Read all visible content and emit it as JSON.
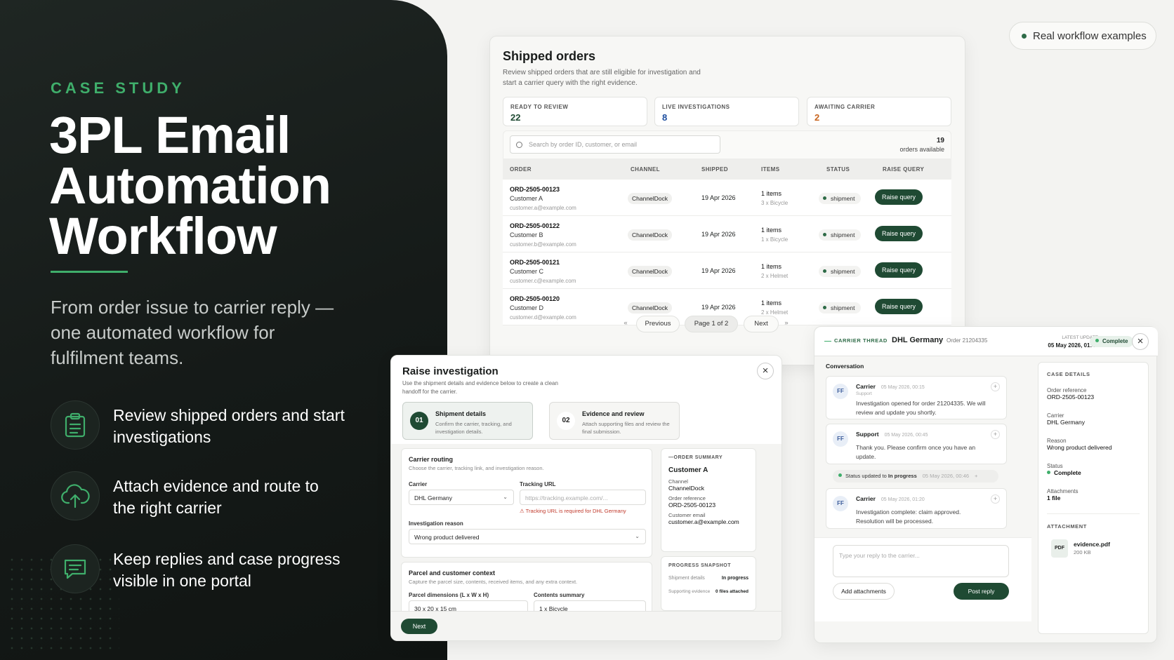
{
  "hero": {
    "eyebrow": "CASE STUDY",
    "title_lines": [
      "3PL Email",
      "Automation",
      "Workflow"
    ],
    "subtitle": "From order issue to carrier reply — one automated workflow for fulfilment teams.",
    "features": [
      {
        "icon": "clipboard-icon",
        "text": "Review shipped orders and start investigations"
      },
      {
        "icon": "upload-cloud-icon",
        "text": "Attach evidence and route to the right carrier"
      },
      {
        "icon": "chat-message-icon",
        "text": "Keep replies and case progress visible in one portal"
      }
    ]
  },
  "badge": {
    "label": "Real workflow examples"
  },
  "colors": {
    "accent": "#3fae6b",
    "primary": "#1f4a33",
    "live": "#1e4fa0",
    "awaiting": "#c8641e"
  },
  "shipped_orders": {
    "title": "Shipped orders",
    "subtitle": "Review shipped orders that are still eligible for investigation and start a carrier query with the right evidence.",
    "stats": [
      {
        "label": "READY TO REVIEW",
        "value": "22"
      },
      {
        "label": "LIVE INVESTIGATIONS",
        "value": "8"
      },
      {
        "label": "AWAITING CARRIER",
        "value": "2"
      }
    ],
    "search_placeholder": "Search by order ID, customer, or email",
    "available_count": "19",
    "available_label": "orders available",
    "columns": [
      "ORDER",
      "CHANNEL",
      "SHIPPED",
      "ITEMS",
      "STATUS",
      "RAISE QUERY"
    ],
    "rows": [
      {
        "id": "ORD-2505-00123",
        "customer": "Customer A",
        "email": "customer.a@example.com",
        "channel": "ChannelDock",
        "shipped": "19 Apr 2026",
        "items": "1 items",
        "item_detail": "3 x Bicycle",
        "status": "shipment",
        "action": "Raise query"
      },
      {
        "id": "ORD-2505-00122",
        "customer": "Customer B",
        "email": "customer.b@example.com",
        "channel": "ChannelDock",
        "shipped": "19 Apr 2026",
        "items": "1 items",
        "item_detail": "1 x Bicycle",
        "status": "shipment",
        "action": "Raise query"
      },
      {
        "id": "ORD-2505-00121",
        "customer": "Customer C",
        "email": "customer.c@example.com",
        "channel": "ChannelDock",
        "shipped": "19 Apr 2026",
        "items": "1 items",
        "item_detail": "2 x Helmet",
        "status": "shipment",
        "action": "Raise query"
      },
      {
        "id": "ORD-2505-00120",
        "customer": "Customer D",
        "email": "customer.d@example.com",
        "channel": "ChannelDock",
        "shipped": "19 Apr 2026",
        "items": "1 items",
        "item_detail": "2 x Helmet",
        "status": "shipment",
        "action": "Raise query"
      }
    ],
    "pager": {
      "first": "«",
      "previous": "Previous",
      "page": "Page 1 of 2",
      "next": "Next",
      "last": "»"
    }
  },
  "investigation": {
    "title": "Raise investigation",
    "subtitle": "Use the shipment details and evidence below to create a clean handoff for the carrier.",
    "close": "×",
    "steps": [
      {
        "num": "01",
        "title": "Shipment details",
        "desc": "Confirm the carrier, tracking, and investigation details."
      },
      {
        "num": "02",
        "title": "Evidence and review",
        "desc": "Attach supporting files and review the final submission."
      }
    ],
    "routing": {
      "title": "Carrier routing",
      "desc": "Choose the carrier, tracking link, and investigation reason.",
      "carrier_label": "Carrier",
      "carrier_value": "DHL Germany",
      "tracking_label": "Tracking URL",
      "tracking_placeholder": "https://tracking.example.com/...",
      "tracking_error": "Tracking URL is required for DHL Germany",
      "reason_label": "Investigation reason",
      "reason_value": "Wrong product delivered"
    },
    "parcel": {
      "title": "Parcel and customer context",
      "desc": "Capture the parcel size, contents, received items, and any extra context.",
      "dims_label": "Parcel dimensions (L x W x H)",
      "dims_value": "30 x 20 x 15 cm",
      "contents_label": "Contents summary",
      "contents_value": "1 x Bicycle"
    },
    "summary": {
      "heading": "ORDER SUMMARY",
      "customer": "Customer A",
      "channel_label": "Channel",
      "channel": "ChannelDock",
      "ref_label": "Order reference",
      "ref": "ORD-2505-00123",
      "email_label": "Customer email",
      "email": "customer.a@example.com"
    },
    "progress": {
      "heading": "PROGRESS SNAPSHOT",
      "row1_label": "Shipment details",
      "row1_value": "In progress",
      "row2_label": "Supporting evidence",
      "row2_value": "0 files attached"
    },
    "next": "Next"
  },
  "thread": {
    "eyebrow": "CARRIER THREAD",
    "carrier": "DHL Germany",
    "order": "Order 21204335",
    "latest_label": "LATEST UPDATE",
    "latest_value": "05 May 2026, 01:48",
    "status": "Complete",
    "close": "×",
    "conversation_label": "Conversation",
    "messages": [
      {
        "avatar": "FF",
        "name": "Carrier",
        "date": "05 May 2026, 00:15",
        "role": "Support",
        "text": "Investigation opened for order 21204335. We will review and update you shortly."
      },
      {
        "avatar": "FF",
        "name": "Support",
        "date": "05 May 2026, 00:45",
        "role": "",
        "text": "Thank you. Please confirm once you have an update."
      },
      {
        "avatar": "FF",
        "name": "Carrier",
        "date": "05 May 2026, 01:20",
        "role": "",
        "text": "Investigation complete: claim approved. Resolution will be processed."
      }
    ],
    "status_update": {
      "prefix": "Status updated to",
      "value": "In progress",
      "date": "05 May 2026, 00:46"
    },
    "reply_placeholder": "Type your reply to the carrier...",
    "add_attachments": "Add attachments",
    "post_reply": "Post reply",
    "case": {
      "heading": "CASE DETAILS",
      "ref_label": "Order reference",
      "ref": "ORD-2505-00123",
      "carrier_label": "Carrier",
      "carrier": "DHL Germany",
      "reason_label": "Reason",
      "reason": "Wrong product delivered",
      "status_label": "Status",
      "status": "Complete",
      "attachments_label": "Attachments",
      "attachments": "1 file",
      "attachment_heading": "ATTACHMENT",
      "file_type": "PDF",
      "file_name": "evidence.pdf",
      "file_size": "200 KB"
    }
  }
}
